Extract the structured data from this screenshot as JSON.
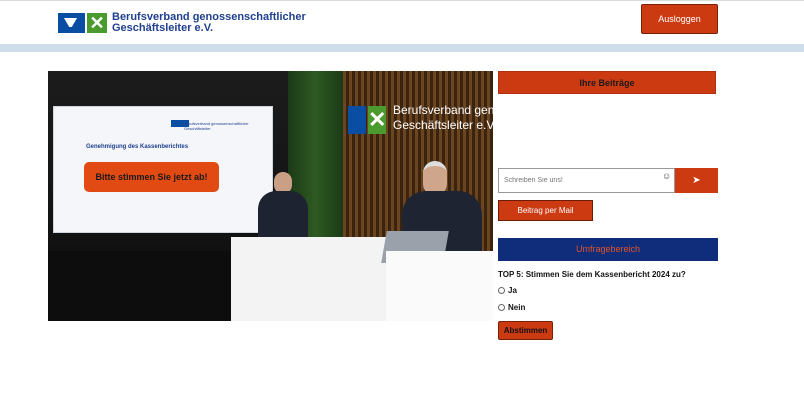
{
  "header": {
    "org_name_line1": "Berufsverband genossenschaftlicher",
    "org_name_line2": "Geschäftsleiter e.V.",
    "logout_label": "Ausloggen"
  },
  "video": {
    "screen_logo_text": "Berufsverband genossenschaftlicher Geschäftsleiter",
    "screen_title": "Genehmigung des Kassenberichtes",
    "screen_button": "Bitte stimmen Sie jetzt ab!",
    "wall_text_line1": "Berufsverband gen",
    "wall_text_line2": "Geschäftsleiter e.V."
  },
  "contributions": {
    "header": "Ihre Beiträge",
    "input_placeholder": "Schreiben Sie uns!",
    "send_icon": "➤",
    "mail_button": "Beitrag per Mail"
  },
  "poll": {
    "header": "Umfragebereich",
    "question": "TOP 5: Stimmen Sie dem Kassenbericht 2024 zu?",
    "options": [
      {
        "label": "Ja"
      },
      {
        "label": "Nein"
      }
    ],
    "submit_label": "Abstimmen"
  },
  "colors": {
    "accent": "#cc3a12",
    "navy": "#0f2d7a",
    "logo_blue": "#0a4ea3",
    "logo_green": "#4a9a2e"
  }
}
